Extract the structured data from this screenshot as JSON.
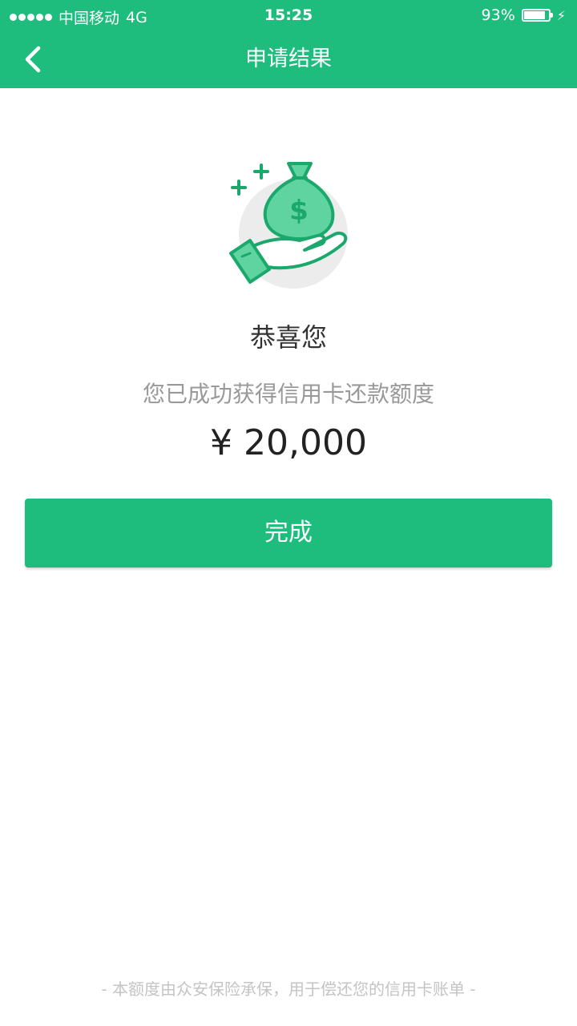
{
  "status_bar": {
    "carrier": "中国移动",
    "network": "4G",
    "time": "15:25",
    "battery_percent_label": "93%",
    "battery_level": 0.93
  },
  "nav": {
    "title": "申请结果",
    "back_icon": "chevron-left-icon"
  },
  "result": {
    "illustration_icon": "money-bag-hand-icon",
    "congrats": "恭喜您",
    "subtitle": "您已成功获得信用卡还款额度",
    "amount": "¥ 20,000"
  },
  "actions": {
    "done_label": "完成"
  },
  "footer": {
    "note": "- 本额度由众安保险承保，用于偿还您的信用卡账单 -"
  },
  "colors": {
    "brand": "#1fbd7d",
    "icon_fill": "#5fd4a0",
    "icon_stroke": "#1aa86c",
    "circle_bg": "#ececec"
  }
}
